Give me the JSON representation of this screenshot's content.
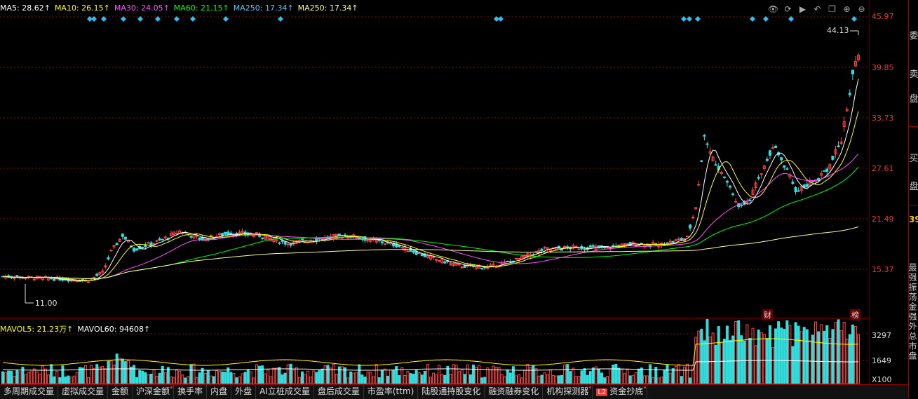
{
  "ma_legend": [
    {
      "label": "MA5: 28.62↑",
      "color": "#ffffff"
    },
    {
      "label": "MA10: 26.15↑",
      "color": "#ffff00"
    },
    {
      "label": "MA30: 24.05↑",
      "color": "#ff55ff"
    },
    {
      "label": "MA60: 21.15↑",
      "color": "#00ff00"
    },
    {
      "label": "MA250: 17.34↑",
      "color": "#55ccff"
    },
    {
      "label": "MA250: 17.34↑",
      "color": "#ffff99"
    }
  ],
  "vol_legend": [
    {
      "label": "MAVOL5: 21.23万↑",
      "color": "#ffff00"
    },
    {
      "label": "MAVOL60: 94608↑",
      "color": "#ffffff"
    }
  ],
  "toolbar_icons": [
    "eye-icon",
    "refresh-icon",
    "play-icon",
    "undo-icon",
    "copy-icon",
    "zoom-in-icon",
    "zoom-out-icon"
  ],
  "price_labels": [
    "45.97",
    "39.85",
    "33.73",
    "27.61",
    "21.49",
    "15.37"
  ],
  "volume_labels": [
    "3297",
    "1649",
    "X100"
  ],
  "annotations": {
    "high": "44.13",
    "low": "11.00",
    "cai": "财",
    "bang": "榜"
  },
  "right_panel": {
    "chars": [
      "委",
      "卖",
      "盘",
      "买",
      "盘"
    ],
    "value": "39",
    "vertical_text": "最强振荡金强外总市盘"
  },
  "bottom_tabs": [
    {
      "label": "多周期成交量",
      "dot": false
    },
    {
      "label": "虚拟成交量",
      "dot": false
    },
    {
      "label": "金额",
      "dot": false
    },
    {
      "label": "沪深金额",
      "dot": true
    },
    {
      "label": "换手率",
      "dot": false
    },
    {
      "label": "内盘",
      "dot": false
    },
    {
      "label": "外盘",
      "dot": false
    },
    {
      "label": "AI立桩成交量",
      "dot": false
    },
    {
      "label": "盘后成交量",
      "dot": false
    },
    {
      "label": "市盈率(ttm)",
      "dot": false
    },
    {
      "label": "陆股通持股变化",
      "dot": false
    },
    {
      "label": "融资融券变化",
      "dot": false
    },
    {
      "label": "机构探测器",
      "dot": true
    },
    {
      "label": "资金抄底",
      "dot": true,
      "badge": "L2"
    }
  ],
  "colors": {
    "up": "#ff4444",
    "down": "#33dddd",
    "grid": "#7a1010"
  }
}
